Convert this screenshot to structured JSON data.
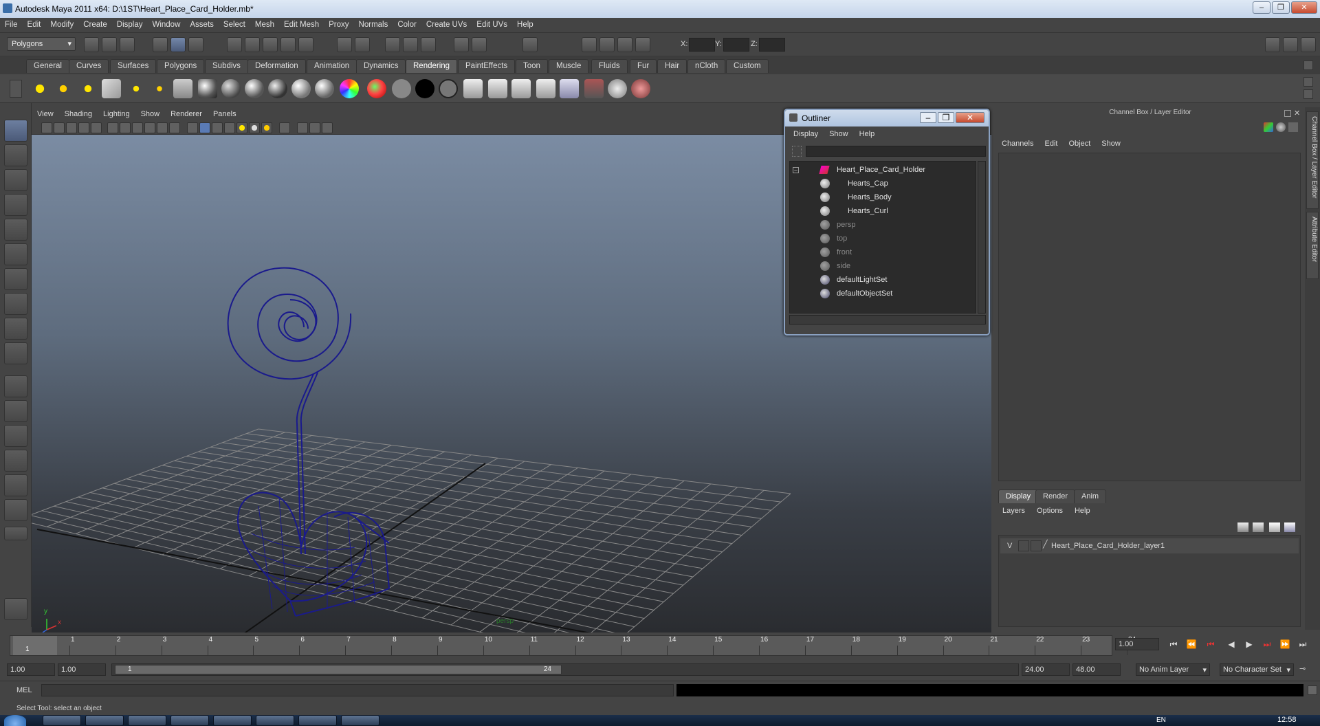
{
  "window": {
    "title": "Autodesk Maya 2011 x64: D:\\1ST\\Heart_Place_Card_Holder.mb*"
  },
  "menubar": [
    "File",
    "Edit",
    "Modify",
    "Create",
    "Display",
    "Window",
    "Assets",
    "Select",
    "Mesh",
    "Edit Mesh",
    "Proxy",
    "Normals",
    "Color",
    "Create UVs",
    "Edit UVs",
    "Help"
  ],
  "statusline": {
    "mode": "Polygons",
    "x_label": "X:",
    "y_label": "Y:",
    "z_label": "Z:"
  },
  "shelf_tabs": [
    "General",
    "Curves",
    "Surfaces",
    "Polygons",
    "Subdivs",
    "Deformation",
    "Animation",
    "Dynamics",
    "Rendering",
    "PaintEffects",
    "Toon",
    "Muscle",
    "Fluids",
    "Fur",
    "Hair",
    "nCloth",
    "Custom"
  ],
  "shelf_active_tab": "Rendering",
  "viewport": {
    "menu": [
      "View",
      "Shading",
      "Lighting",
      "Show",
      "Renderer",
      "Panels"
    ],
    "camera_label": "persp"
  },
  "outliner": {
    "title": "Outliner",
    "menu": [
      "Display",
      "Show",
      "Help"
    ],
    "items": [
      {
        "label": "Heart_Place_Card_Holder",
        "dim": false
      },
      {
        "label": "Hearts_Cap",
        "dim": false
      },
      {
        "label": "Hearts_Body",
        "dim": false
      },
      {
        "label": "Hearts_Curl",
        "dim": false
      },
      {
        "label": "persp",
        "dim": true
      },
      {
        "label": "top",
        "dim": true
      },
      {
        "label": "front",
        "dim": true
      },
      {
        "label": "side",
        "dim": true
      },
      {
        "label": "defaultLightSet",
        "dim": false
      },
      {
        "label": "defaultObjectSet",
        "dim": false
      }
    ]
  },
  "channelbox": {
    "title": "Channel Box / Layer Editor",
    "menu": [
      "Channels",
      "Edit",
      "Object",
      "Show"
    ]
  },
  "sidetabs": [
    "Channel Box / Layer Editor",
    "Attribute Editor"
  ],
  "layereditor": {
    "tabs": [
      "Display",
      "Render",
      "Anim"
    ],
    "menu": [
      "Layers",
      "Options",
      "Help"
    ],
    "layer": {
      "visible": "V",
      "name": "Heart_Place_Card_Holder_layer1"
    }
  },
  "timeslider": {
    "ticks": [
      "1",
      "2",
      "3",
      "4",
      "5",
      "6",
      "7",
      "8",
      "9",
      "10",
      "11",
      "12",
      "13",
      "14",
      "15",
      "16",
      "17",
      "18",
      "19",
      "20",
      "21",
      "22",
      "23",
      "24"
    ],
    "current_frame": "1",
    "current_time": "1.00"
  },
  "rangeslider": {
    "start": "1.00",
    "playback_start": "1.00",
    "range_start_label": "1",
    "range_end_label": "24",
    "playback_end": "24.00",
    "end": "48.00",
    "anim_layer": "No Anim Layer",
    "character_set": "No Character Set"
  },
  "cmdline": {
    "label": "MEL"
  },
  "helpline": {
    "text": "Select Tool: select an object"
  },
  "taskbar": {
    "clock": "12:58",
    "lang": "EN"
  },
  "colors": {
    "wire": "#1a1a8c",
    "accent": "#6d7fa0"
  }
}
